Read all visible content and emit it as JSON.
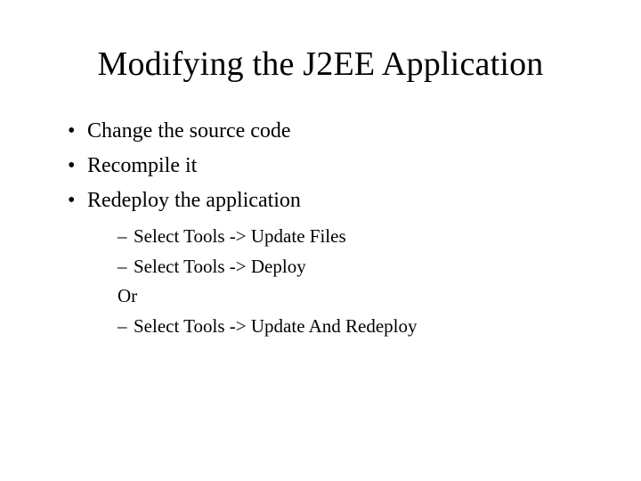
{
  "title": "Modifying the J2EE Application",
  "bullets": {
    "b1": "Change the source code",
    "b2": "Recompile it",
    "b3": "Redeploy the application"
  },
  "sub": {
    "s1": "Select Tools -> Update Files",
    "s2": "Select Tools -> Deploy",
    "s3": "Or",
    "s4": "Select Tools -> Update And Redeploy"
  }
}
